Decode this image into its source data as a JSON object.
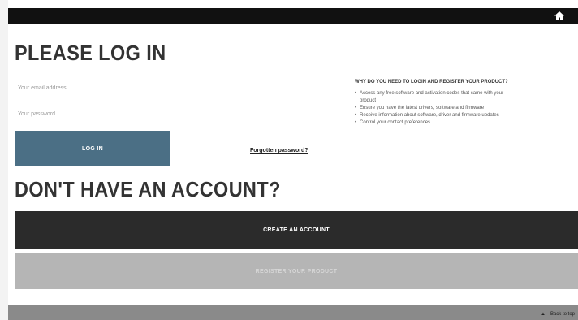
{
  "header": {
    "home_icon": "home-icon"
  },
  "login": {
    "title": "PLEASE LOG IN",
    "email_placeholder": "Your email address",
    "password_placeholder": "Your password",
    "login_label": "LOG IN",
    "forgot_label": "Forgotten password?"
  },
  "why": {
    "title": "WHY DO YOU NEED TO LOGIN AND REGISTER YOUR PRODUCT?",
    "items": [
      {
        "line1": "Access any free software and activation codes that came with your",
        "line2": "product"
      },
      {
        "line1": "Ensure you have the latest drivers, software and firmware",
        "line2": ""
      },
      {
        "line1": "Receive information about software, driver and firmware updates",
        "line2": ""
      },
      {
        "line1": "Control your contact preferences",
        "line2": ""
      }
    ],
    "bullet": "•"
  },
  "account": {
    "title": "DON'T HAVE AN ACCOUNT?",
    "create_label": "CREATE AN ACCOUNT",
    "register_label": "REGISTER YOUR PRODUCT"
  },
  "footer": {
    "arrow": "▲",
    "back_to_top": "Back to top"
  },
  "colors": {
    "top_bar": "#111111",
    "login_button": "#4b6f85",
    "create_button": "#2b2b2b",
    "register_button": "#b5b5b5",
    "footer": "#8a8a8a"
  }
}
